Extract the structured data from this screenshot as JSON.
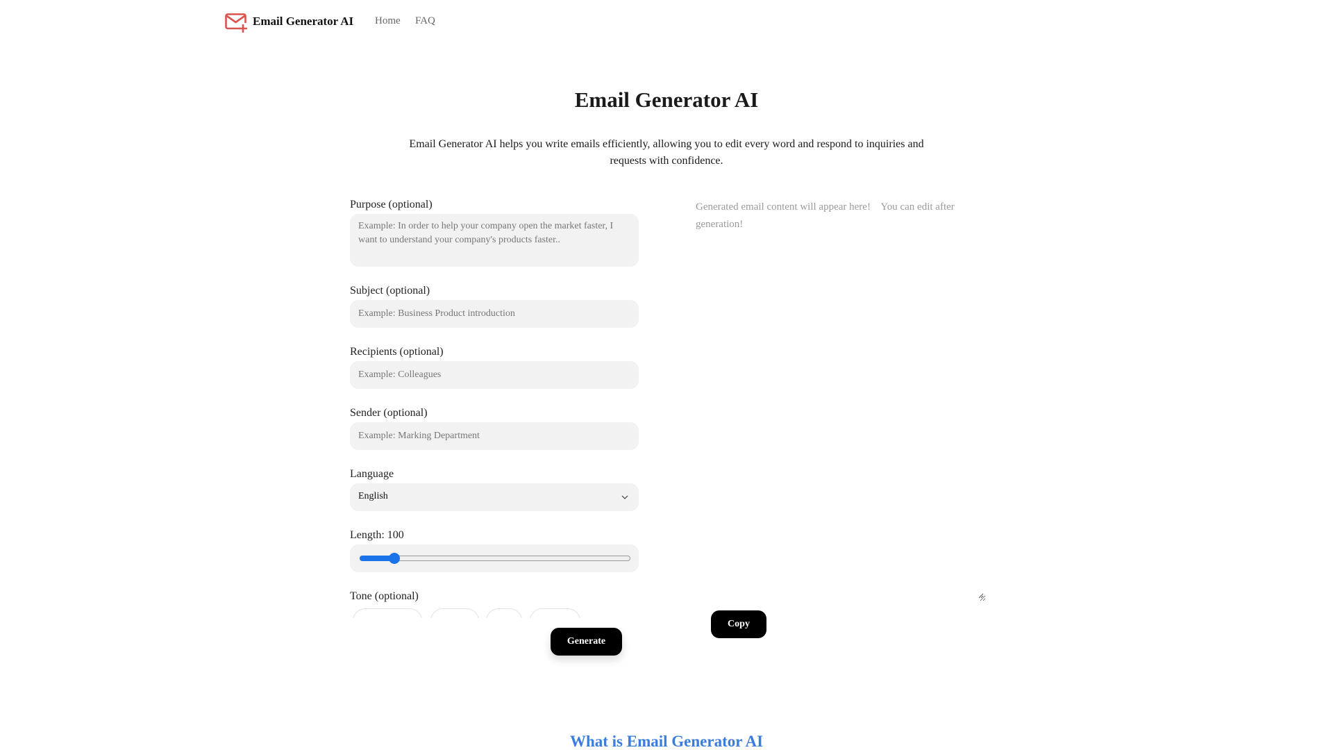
{
  "nav": {
    "brand": "Email Generator AI",
    "logo_icon": "mail-plus-icon",
    "links": [
      {
        "label": "Home"
      },
      {
        "label": "FAQ"
      }
    ]
  },
  "hero": {
    "title": "Email Generator AI",
    "subtitle": "Email Generator AI helps you write emails efficiently, allowing you to edit every word and respond to inquiries and requests with confidence."
  },
  "form": {
    "purpose": {
      "label": "Purpose (optional)",
      "placeholder": "Example: In order to help your company open the market faster, I want to understand your company's products faster..",
      "value": ""
    },
    "subject": {
      "label": "Subject (optional)",
      "placeholder": "Example: Business Product introduction",
      "value": ""
    },
    "recipients": {
      "label": "Recipients (optional)",
      "placeholder": "Example: Colleagues",
      "value": ""
    },
    "sender": {
      "label": "Sender (optional)",
      "placeholder": "Example: Marking Department",
      "value": ""
    },
    "language": {
      "label": "Language",
      "selected": "English"
    },
    "length": {
      "label": "Length: 100",
      "value": 100,
      "fraction": 0.125
    },
    "tone": {
      "label": "Tone (optional)",
      "chip_count": 4
    },
    "generate_label": "Generate"
  },
  "output": {
    "placeholder": "Generated email content will appear here!    You can edit after generation!",
    "value": "",
    "copy_label": "Copy"
  },
  "colors": {
    "accent": "#1a73e8",
    "logo": "#d9534f",
    "section_heading": "#3b7ddd",
    "button": "#000000"
  },
  "section": {
    "heading": "What is Email Generator AI"
  }
}
